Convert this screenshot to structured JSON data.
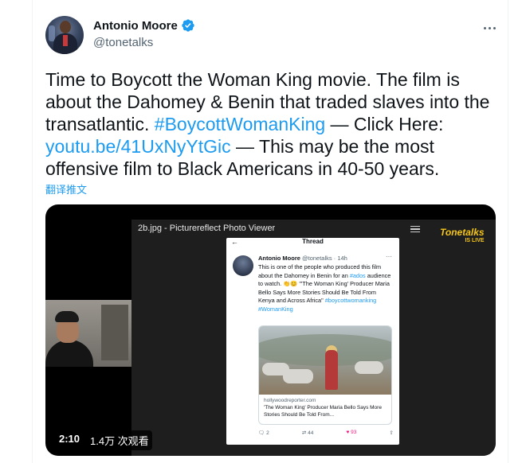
{
  "tweet": {
    "display_name": "Antonio Moore",
    "handle": "@tonetalks",
    "text_part1": "Time to Boycott the Woman King movie. The film is about the Dahomey & Benin that traded slaves into the transatlantic. ",
    "hashtag": "#BoycottWomanKing",
    "text_part2": " — Click Here: ",
    "link": "youtu.be/41UxNyYtGic",
    "text_part3": " — This may be the most offensive film to Black Americans in 40-50 years.",
    "translate_label": "翻译推文",
    "icons": [
      "verified-icon",
      "more-icon"
    ]
  },
  "media": {
    "duration": "2:10",
    "views": "1.4万 次观看",
    "viewer_title": "2b.jpg - Picturereflect Photo Viewer",
    "brand_name": "Tonetalks",
    "brand_sub": "IS LIVE",
    "embedded_post": {
      "header": "Thread",
      "name": "Antonio Moore",
      "handle_time": "@tonetalks · 14h",
      "body_before": "This is one of the people who produced this film about the Dahomey in Benin for an ",
      "ados": "#ados",
      "body_middle": " audience to watch. 👏😊 \"'The Woman King' Producer Maria Bello Says More Stories Should Be Told From Kenya and Across Africa\" ",
      "tags": "#boycottwomanking #WomanKing",
      "card_domain": "hollywoodreporter.com",
      "card_title": "'The Woman King' Producer Maria Bello Says More Stories Should Be Told From...",
      "replies": "2",
      "retweets": "44",
      "likes": "93"
    }
  },
  "colors": {
    "accent": "#1d9bf0",
    "text": "#0f1419",
    "secondary": "#536471"
  }
}
